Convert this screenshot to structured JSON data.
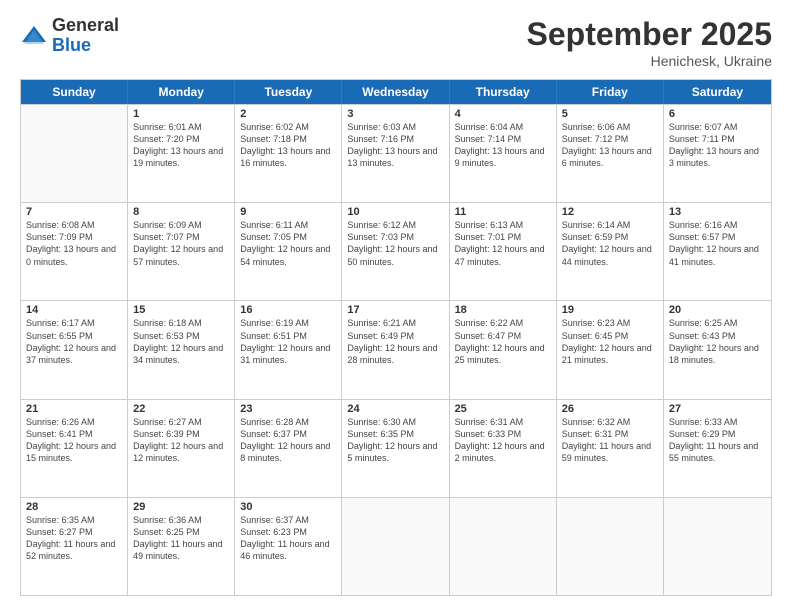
{
  "header": {
    "logo_general": "General",
    "logo_blue": "Blue",
    "month_title": "September 2025",
    "subtitle": "Henichesk, Ukraine"
  },
  "weekdays": [
    "Sunday",
    "Monday",
    "Tuesday",
    "Wednesday",
    "Thursday",
    "Friday",
    "Saturday"
  ],
  "rows": [
    [
      {
        "day": "",
        "info": ""
      },
      {
        "day": "1",
        "info": "Sunrise: 6:01 AM\nSunset: 7:20 PM\nDaylight: 13 hours\nand 19 minutes."
      },
      {
        "day": "2",
        "info": "Sunrise: 6:02 AM\nSunset: 7:18 PM\nDaylight: 13 hours\nand 16 minutes."
      },
      {
        "day": "3",
        "info": "Sunrise: 6:03 AM\nSunset: 7:16 PM\nDaylight: 13 hours\nand 13 minutes."
      },
      {
        "day": "4",
        "info": "Sunrise: 6:04 AM\nSunset: 7:14 PM\nDaylight: 13 hours\nand 9 minutes."
      },
      {
        "day": "5",
        "info": "Sunrise: 6:06 AM\nSunset: 7:12 PM\nDaylight: 13 hours\nand 6 minutes."
      },
      {
        "day": "6",
        "info": "Sunrise: 6:07 AM\nSunset: 7:11 PM\nDaylight: 13 hours\nand 3 minutes."
      }
    ],
    [
      {
        "day": "7",
        "info": "Sunrise: 6:08 AM\nSunset: 7:09 PM\nDaylight: 13 hours\nand 0 minutes."
      },
      {
        "day": "8",
        "info": "Sunrise: 6:09 AM\nSunset: 7:07 PM\nDaylight: 12 hours\nand 57 minutes."
      },
      {
        "day": "9",
        "info": "Sunrise: 6:11 AM\nSunset: 7:05 PM\nDaylight: 12 hours\nand 54 minutes."
      },
      {
        "day": "10",
        "info": "Sunrise: 6:12 AM\nSunset: 7:03 PM\nDaylight: 12 hours\nand 50 minutes."
      },
      {
        "day": "11",
        "info": "Sunrise: 6:13 AM\nSunset: 7:01 PM\nDaylight: 12 hours\nand 47 minutes."
      },
      {
        "day": "12",
        "info": "Sunrise: 6:14 AM\nSunset: 6:59 PM\nDaylight: 12 hours\nand 44 minutes."
      },
      {
        "day": "13",
        "info": "Sunrise: 6:16 AM\nSunset: 6:57 PM\nDaylight: 12 hours\nand 41 minutes."
      }
    ],
    [
      {
        "day": "14",
        "info": "Sunrise: 6:17 AM\nSunset: 6:55 PM\nDaylight: 12 hours\nand 37 minutes."
      },
      {
        "day": "15",
        "info": "Sunrise: 6:18 AM\nSunset: 6:53 PM\nDaylight: 12 hours\nand 34 minutes."
      },
      {
        "day": "16",
        "info": "Sunrise: 6:19 AM\nSunset: 6:51 PM\nDaylight: 12 hours\nand 31 minutes."
      },
      {
        "day": "17",
        "info": "Sunrise: 6:21 AM\nSunset: 6:49 PM\nDaylight: 12 hours\nand 28 minutes."
      },
      {
        "day": "18",
        "info": "Sunrise: 6:22 AM\nSunset: 6:47 PM\nDaylight: 12 hours\nand 25 minutes."
      },
      {
        "day": "19",
        "info": "Sunrise: 6:23 AM\nSunset: 6:45 PM\nDaylight: 12 hours\nand 21 minutes."
      },
      {
        "day": "20",
        "info": "Sunrise: 6:25 AM\nSunset: 6:43 PM\nDaylight: 12 hours\nand 18 minutes."
      }
    ],
    [
      {
        "day": "21",
        "info": "Sunrise: 6:26 AM\nSunset: 6:41 PM\nDaylight: 12 hours\nand 15 minutes."
      },
      {
        "day": "22",
        "info": "Sunrise: 6:27 AM\nSunset: 6:39 PM\nDaylight: 12 hours\nand 12 minutes."
      },
      {
        "day": "23",
        "info": "Sunrise: 6:28 AM\nSunset: 6:37 PM\nDaylight: 12 hours\nand 8 minutes."
      },
      {
        "day": "24",
        "info": "Sunrise: 6:30 AM\nSunset: 6:35 PM\nDaylight: 12 hours\nand 5 minutes."
      },
      {
        "day": "25",
        "info": "Sunrise: 6:31 AM\nSunset: 6:33 PM\nDaylight: 12 hours\nand 2 minutes."
      },
      {
        "day": "26",
        "info": "Sunrise: 6:32 AM\nSunset: 6:31 PM\nDaylight: 11 hours\nand 59 minutes."
      },
      {
        "day": "27",
        "info": "Sunrise: 6:33 AM\nSunset: 6:29 PM\nDaylight: 11 hours\nand 55 minutes."
      }
    ],
    [
      {
        "day": "28",
        "info": "Sunrise: 6:35 AM\nSunset: 6:27 PM\nDaylight: 11 hours\nand 52 minutes."
      },
      {
        "day": "29",
        "info": "Sunrise: 6:36 AM\nSunset: 6:25 PM\nDaylight: 11 hours\nand 49 minutes."
      },
      {
        "day": "30",
        "info": "Sunrise: 6:37 AM\nSunset: 6:23 PM\nDaylight: 11 hours\nand 46 minutes."
      },
      {
        "day": "",
        "info": ""
      },
      {
        "day": "",
        "info": ""
      },
      {
        "day": "",
        "info": ""
      },
      {
        "day": "",
        "info": ""
      }
    ]
  ]
}
